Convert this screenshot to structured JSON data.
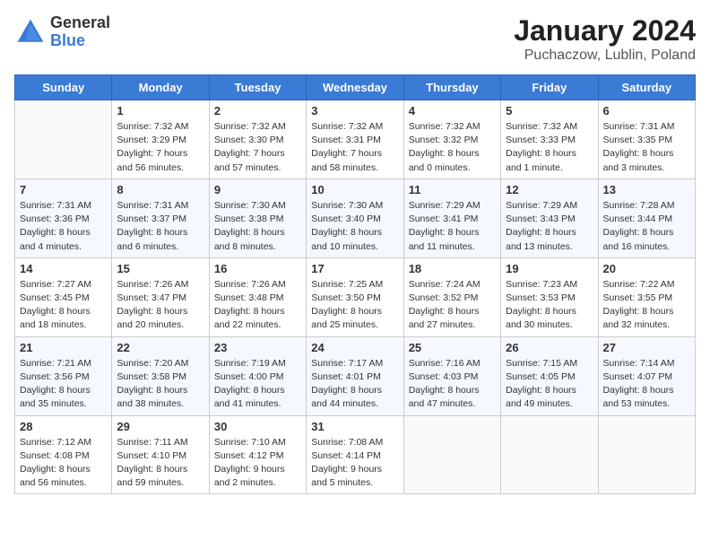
{
  "logo": {
    "general": "General",
    "blue": "Blue"
  },
  "header": {
    "month": "January 2024",
    "location": "Puchaczow, Lublin, Poland"
  },
  "days_of_week": [
    "Sunday",
    "Monday",
    "Tuesday",
    "Wednesday",
    "Thursday",
    "Friday",
    "Saturday"
  ],
  "weeks": [
    [
      {
        "day": "",
        "info": ""
      },
      {
        "day": "1",
        "info": "Sunrise: 7:32 AM\nSunset: 3:29 PM\nDaylight: 7 hours\nand 56 minutes."
      },
      {
        "day": "2",
        "info": "Sunrise: 7:32 AM\nSunset: 3:30 PM\nDaylight: 7 hours\nand 57 minutes."
      },
      {
        "day": "3",
        "info": "Sunrise: 7:32 AM\nSunset: 3:31 PM\nDaylight: 7 hours\nand 58 minutes."
      },
      {
        "day": "4",
        "info": "Sunrise: 7:32 AM\nSunset: 3:32 PM\nDaylight: 8 hours\nand 0 minutes."
      },
      {
        "day": "5",
        "info": "Sunrise: 7:32 AM\nSunset: 3:33 PM\nDaylight: 8 hours\nand 1 minute."
      },
      {
        "day": "6",
        "info": "Sunrise: 7:31 AM\nSunset: 3:35 PM\nDaylight: 8 hours\nand 3 minutes."
      }
    ],
    [
      {
        "day": "7",
        "info": "Sunrise: 7:31 AM\nSunset: 3:36 PM\nDaylight: 8 hours\nand 4 minutes."
      },
      {
        "day": "8",
        "info": "Sunrise: 7:31 AM\nSunset: 3:37 PM\nDaylight: 8 hours\nand 6 minutes."
      },
      {
        "day": "9",
        "info": "Sunrise: 7:30 AM\nSunset: 3:38 PM\nDaylight: 8 hours\nand 8 minutes."
      },
      {
        "day": "10",
        "info": "Sunrise: 7:30 AM\nSunset: 3:40 PM\nDaylight: 8 hours\nand 10 minutes."
      },
      {
        "day": "11",
        "info": "Sunrise: 7:29 AM\nSunset: 3:41 PM\nDaylight: 8 hours\nand 11 minutes."
      },
      {
        "day": "12",
        "info": "Sunrise: 7:29 AM\nSunset: 3:43 PM\nDaylight: 8 hours\nand 13 minutes."
      },
      {
        "day": "13",
        "info": "Sunrise: 7:28 AM\nSunset: 3:44 PM\nDaylight: 8 hours\nand 16 minutes."
      }
    ],
    [
      {
        "day": "14",
        "info": "Sunrise: 7:27 AM\nSunset: 3:45 PM\nDaylight: 8 hours\nand 18 minutes."
      },
      {
        "day": "15",
        "info": "Sunrise: 7:26 AM\nSunset: 3:47 PM\nDaylight: 8 hours\nand 20 minutes."
      },
      {
        "day": "16",
        "info": "Sunrise: 7:26 AM\nSunset: 3:48 PM\nDaylight: 8 hours\nand 22 minutes."
      },
      {
        "day": "17",
        "info": "Sunrise: 7:25 AM\nSunset: 3:50 PM\nDaylight: 8 hours\nand 25 minutes."
      },
      {
        "day": "18",
        "info": "Sunrise: 7:24 AM\nSunset: 3:52 PM\nDaylight: 8 hours\nand 27 minutes."
      },
      {
        "day": "19",
        "info": "Sunrise: 7:23 AM\nSunset: 3:53 PM\nDaylight: 8 hours\nand 30 minutes."
      },
      {
        "day": "20",
        "info": "Sunrise: 7:22 AM\nSunset: 3:55 PM\nDaylight: 8 hours\nand 32 minutes."
      }
    ],
    [
      {
        "day": "21",
        "info": "Sunrise: 7:21 AM\nSunset: 3:56 PM\nDaylight: 8 hours\nand 35 minutes."
      },
      {
        "day": "22",
        "info": "Sunrise: 7:20 AM\nSunset: 3:58 PM\nDaylight: 8 hours\nand 38 minutes."
      },
      {
        "day": "23",
        "info": "Sunrise: 7:19 AM\nSunset: 4:00 PM\nDaylight: 8 hours\nand 41 minutes."
      },
      {
        "day": "24",
        "info": "Sunrise: 7:17 AM\nSunset: 4:01 PM\nDaylight: 8 hours\nand 44 minutes."
      },
      {
        "day": "25",
        "info": "Sunrise: 7:16 AM\nSunset: 4:03 PM\nDaylight: 8 hours\nand 47 minutes."
      },
      {
        "day": "26",
        "info": "Sunrise: 7:15 AM\nSunset: 4:05 PM\nDaylight: 8 hours\nand 49 minutes."
      },
      {
        "day": "27",
        "info": "Sunrise: 7:14 AM\nSunset: 4:07 PM\nDaylight: 8 hours\nand 53 minutes."
      }
    ],
    [
      {
        "day": "28",
        "info": "Sunrise: 7:12 AM\nSunset: 4:08 PM\nDaylight: 8 hours\nand 56 minutes."
      },
      {
        "day": "29",
        "info": "Sunrise: 7:11 AM\nSunset: 4:10 PM\nDaylight: 8 hours\nand 59 minutes."
      },
      {
        "day": "30",
        "info": "Sunrise: 7:10 AM\nSunset: 4:12 PM\nDaylight: 9 hours\nand 2 minutes."
      },
      {
        "day": "31",
        "info": "Sunrise: 7:08 AM\nSunset: 4:14 PM\nDaylight: 9 hours\nand 5 minutes."
      },
      {
        "day": "",
        "info": ""
      },
      {
        "day": "",
        "info": ""
      },
      {
        "day": "",
        "info": ""
      }
    ]
  ]
}
